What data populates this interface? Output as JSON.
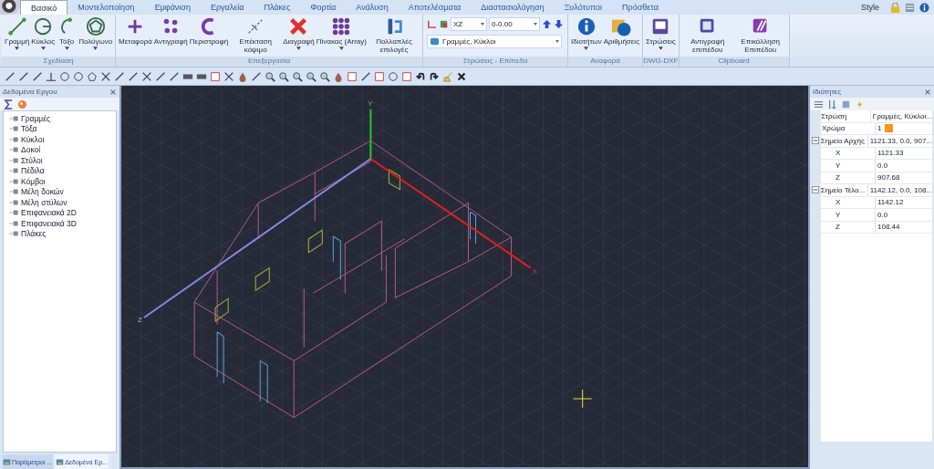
{
  "tabs": [
    {
      "label": "Βασικό",
      "selected": true
    },
    {
      "label": "Μοντελοποίηση",
      "selected": false
    },
    {
      "label": "Εμφάνιση",
      "selected": false
    },
    {
      "label": "Εργαλεία",
      "selected": false
    },
    {
      "label": "Πλάκες",
      "selected": false
    },
    {
      "label": "Φορτία",
      "selected": false
    },
    {
      "label": "Ανάλυση",
      "selected": false
    },
    {
      "label": "Αποτελέσματα",
      "selected": false
    },
    {
      "label": "Διαστασιολόγηση",
      "selected": false
    },
    {
      "label": "Ξυλότυποι",
      "selected": false
    },
    {
      "label": "Πρόσθετα",
      "selected": false
    }
  ],
  "style_menu": "Style",
  "ribbon": [
    {
      "title": "Σχεδίαση",
      "buttons": [
        {
          "label": "Γραμμή",
          "dropdown": true
        },
        {
          "label": "Κύκλος",
          "dropdown": true
        },
        {
          "label": "Τόξο",
          "dropdown": true
        },
        {
          "label": "Πολύγωνο",
          "dropdown": true
        }
      ]
    },
    {
      "title": "Επεξεργασία",
      "buttons": [
        {
          "label": "Μεταφορά",
          "dropdown": false
        },
        {
          "label": "Αντιγραφή",
          "dropdown": false
        },
        {
          "label": "Περιστροφή",
          "dropdown": false
        },
        {
          "label": "Επέκταση κόψιμο",
          "dropdown": false
        },
        {
          "label": "Διαγραφή",
          "dropdown": true
        },
        {
          "label": "Πίνακας (Array)",
          "dropdown": true
        },
        {
          "label": "Πολλαπλές επιλογές",
          "dropdown": false
        }
      ]
    },
    {
      "title": "Στρώσεις - Επίπεδα",
      "fields": {
        "plane": "XZ",
        "level": "0-0.00",
        "layer": "Γραμμές, Κύκλοι"
      }
    },
    {
      "title": "Αναφορά",
      "buttons": [
        {
          "label": "Ιδιοτήτων",
          "dropdown": true
        },
        {
          "label": "Αριθμήσεις",
          "dropdown": false
        }
      ]
    },
    {
      "title": "DWG-DXF",
      "buttons": [
        {
          "label": "Στρώσεις",
          "dropdown": true
        }
      ]
    },
    {
      "title": "Clipboard",
      "buttons": [
        {
          "label": "Αντιγραφή επιπέδου",
          "dropdown": false
        },
        {
          "label": "Επικόλληση Επιπέδου",
          "dropdown": false
        }
      ]
    }
  ],
  "project_panel": {
    "title": "Δεδομένα Εργου",
    "items": [
      "Γραμμές",
      "Τόξα",
      "Κύκλοι",
      "Δοκοί",
      "Στύλοι",
      "Πέδιλα",
      "Κόμβοι",
      "Μέλη δοκών",
      "Μέλη στύλων",
      "Επιφανειακά 2D",
      "Επιφανειακά 3D",
      "Πλάκες"
    ],
    "bottom_tabs": [
      {
        "label": "Παράμετροι ...",
        "selected": false
      },
      {
        "label": "Δεδομένα Ερ...",
        "selected": true
      }
    ]
  },
  "viewport": {
    "axes": {
      "x": "X",
      "y": "Y",
      "z": "Z"
    }
  },
  "properties": {
    "title": "Ιδιότητες",
    "rows": [
      {
        "name": "Στρώση",
        "value": "Γραμμές, Κύκλοι..."
      },
      {
        "name": "Χρώμα",
        "value": "1",
        "color": "#f7941d"
      },
      {
        "name": "Σημείο Αρχής",
        "value": "1121.33, 0.0, 907...",
        "expanded": true,
        "children": [
          {
            "name": "X",
            "value": "1121.33"
          },
          {
            "name": "Y",
            "value": "0.0"
          },
          {
            "name": "Z",
            "value": "907.68"
          }
        ]
      },
      {
        "name": "Σημείο Τέλο...",
        "value": "1142.12, 0.0, 108...",
        "expanded": true,
        "children": [
          {
            "name": "X",
            "value": "1142.12"
          },
          {
            "name": "Y",
            "value": "0.0"
          },
          {
            "name": "Z",
            "value": "108.44"
          }
        ]
      }
    ]
  }
}
